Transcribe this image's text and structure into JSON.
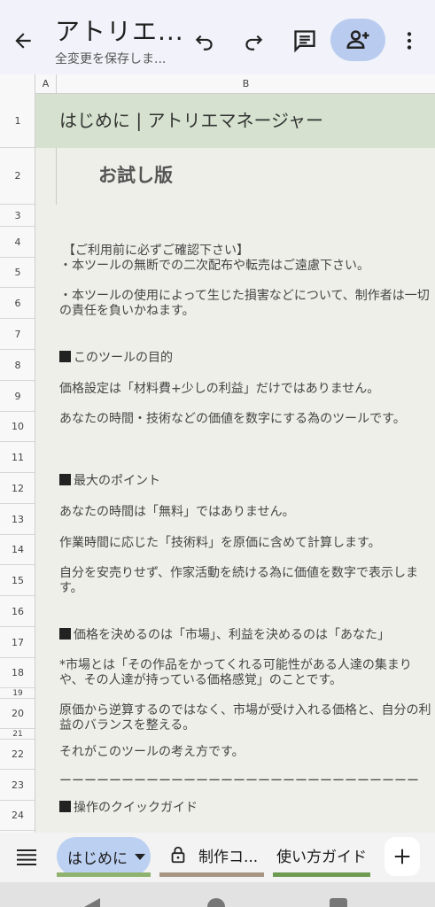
{
  "appbar": {
    "title": "アトリエ...",
    "subtitle": "全変更を保存しま..."
  },
  "columns": {
    "a": "A",
    "b": "B"
  },
  "rows": [
    {
      "n": "1",
      "h": 61
    },
    {
      "n": "2",
      "h": 64
    },
    {
      "n": "3",
      "h": 25
    },
    {
      "n": "4",
      "h": 35
    },
    {
      "n": "5",
      "h": 34
    },
    {
      "n": "6",
      "h": 35
    },
    {
      "n": "7",
      "h": 35
    },
    {
      "n": "8",
      "h": 35
    },
    {
      "n": "9",
      "h": 35
    },
    {
      "n": "10",
      "h": 34
    },
    {
      "n": "11",
      "h": 35
    },
    {
      "n": "12",
      "h": 35
    },
    {
      "n": "13",
      "h": 35
    },
    {
      "n": "14",
      "h": 34
    },
    {
      "n": "15",
      "h": 35
    },
    {
      "n": "16",
      "h": 35
    },
    {
      "n": "17",
      "h": 35
    },
    {
      "n": "18",
      "h": 34
    },
    {
      "n": "19",
      "h": 12
    },
    {
      "n": "20",
      "h": 34
    },
    {
      "n": "21",
      "h": 12
    },
    {
      "n": "22",
      "h": 34
    },
    {
      "n": "23",
      "h": 35
    },
    {
      "n": "24",
      "h": 34
    }
  ],
  "content": {
    "r1": "はじめに | アトリエマネージャー",
    "r2": "お試し版",
    "r4": "【ご利用前に必ずご確認下さい】",
    "r5": "・本ツールの無断での二次配布や転売はご遠慮下さい。",
    "r6": "・本ツールの使用によって生じた損害などについて、制作者は一切の責任を負いかねます。",
    "r8": "このツールの目的",
    "r9": "価格設定は「材料費+少しの利益」だけではありません。",
    "r10": "あなたの時間・技術などの価値を数字にする為のツールです。",
    "r12": "最大のポイント",
    "r13": "あなたの時間は「無料」ではありません。",
    "r14": "作業時間に応じた「技術料」を原価に含めて計算します。",
    "r15": "自分を安売りせず、作家活動を続ける為に価値を数字で表示します。",
    "r17": "価格を決めるのは「市場」、利益を決めるのは「あなた」",
    "r18": "*市場とは「その作品をかってくれる可能性がある人達の集まりや、その人達が持っている価格感覚」のことです。",
    "r20": "原価から逆算するのではなく、市場が受け入れる価格と、自分の利益のバランスを整える。",
    "r22": "それがこのツールの考え方です。",
    "r23": "ーーーーーーーーーーーーーーーーーーーーーーーーーーーーー",
    "r24": "操作のクイックガイド"
  },
  "tabs": {
    "active": "はじめに",
    "second": "制作コ...",
    "third": "使い方ガイド",
    "active_color": "#8fb36f",
    "second_color": "#a89482",
    "third_color": "#6f9a52"
  },
  "icons": {
    "back": "arrow-back-icon",
    "undo": "undo-icon",
    "redo": "redo-icon",
    "comment": "comment-icon",
    "share": "person-add-icon",
    "more": "more-vert-icon",
    "menu": "menu-icon",
    "lock": "lock-icon",
    "add": "plus-icon"
  }
}
